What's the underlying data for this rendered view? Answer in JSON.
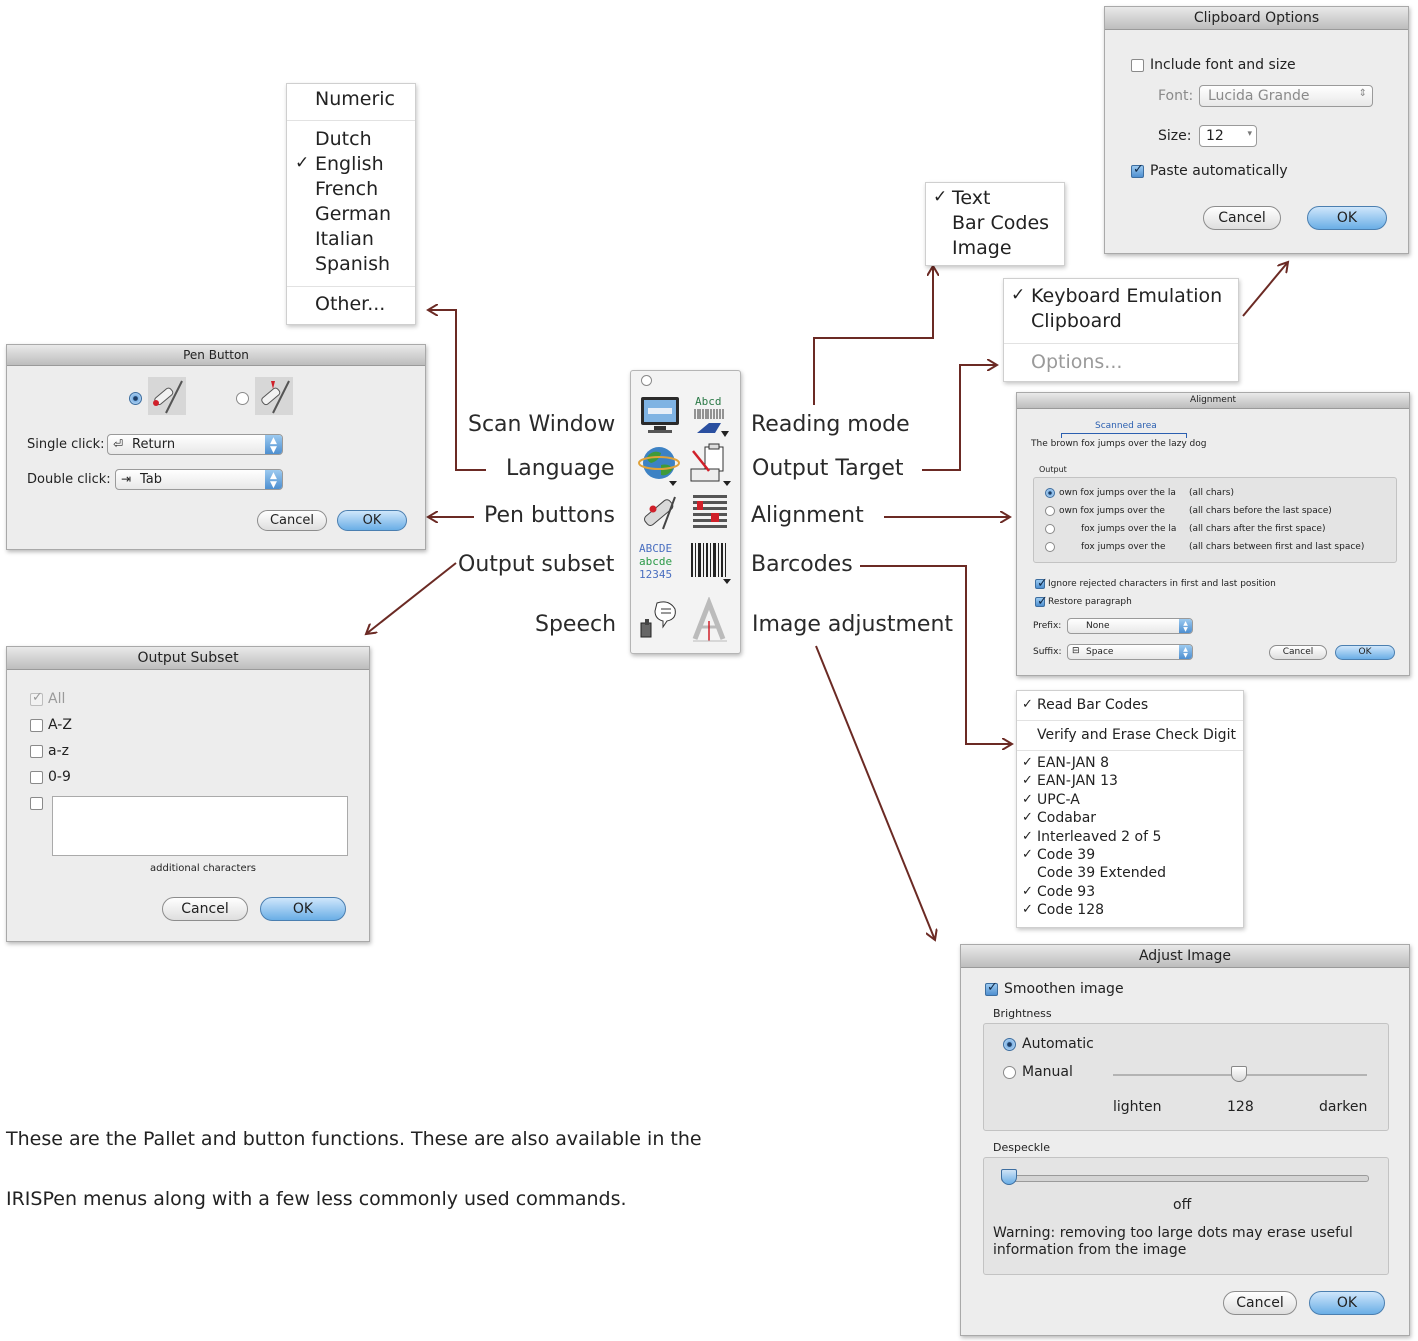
{
  "language_menu": {
    "items": [
      "Numeric",
      "Dutch",
      "English",
      "French",
      "German",
      "Italian",
      "Spanish",
      "Other..."
    ],
    "checked": "English"
  },
  "pen_button": {
    "title": "Pen Button",
    "single_click_label": "Single click:",
    "single_click_value": "Return",
    "double_click_label": "Double click:",
    "double_click_value": "Tab",
    "cancel": "Cancel",
    "ok": "OK"
  },
  "output_subset": {
    "title": "Output Subset",
    "options": [
      "All",
      "A-Z",
      "a-z",
      "0-9"
    ],
    "additional_label": "additional characters",
    "cancel": "Cancel",
    "ok": "OK"
  },
  "palette": {
    "left_labels": [
      "Scan Window",
      "Language",
      "Pen buttons",
      "Output subset",
      "Speech"
    ],
    "right_labels": [
      "Reading mode",
      "Output Target",
      "Alignment",
      "Barcodes",
      "Image adjustment"
    ],
    "icon_texts": {
      "abcd": "Abcd",
      "abcde_upper": "ABCDE",
      "abcde_lower": "abcde",
      "digits": "12345"
    }
  },
  "reading_mode_menu": {
    "items": [
      "Text",
      "Bar Codes",
      "Image"
    ],
    "checked": "Text"
  },
  "output_target_menu": {
    "items": [
      "Keyboard Emulation",
      "Clipboard"
    ],
    "checked": "Keyboard Emulation",
    "options": "Options..."
  },
  "clipboard_options": {
    "title": "Clipboard Options",
    "include_font": "Include font and size",
    "font_label": "Font:",
    "font_value": "Lucida Grande",
    "size_label": "Size:",
    "size_value": "12",
    "paste_auto": "Paste automatically",
    "cancel": "Cancel",
    "ok": "OK"
  },
  "alignment": {
    "title": "Alignment",
    "scanned_area": "Scanned area",
    "sample_text": "The brown fox jumps over the lazy dog",
    "output_label": "Output",
    "options": [
      {
        "text": "own fox jumps over the la",
        "desc": "(all chars)"
      },
      {
        "text": "own fox jumps over the",
        "desc": "(all chars before the last space)"
      },
      {
        "text": "fox jumps over the la",
        "desc": "(all chars after the first space)"
      },
      {
        "text": "fox jumps over the",
        "desc": "(all chars between first and last space)"
      }
    ],
    "ignore_rejected": "Ignore rejected characters in first and last position",
    "restore_paragraph": "Restore paragraph",
    "prefix_label": "Prefix:",
    "prefix_value": "None",
    "suffix_label": "Suffix:",
    "suffix_value": "Space",
    "cancel": "Cancel",
    "ok": "OK"
  },
  "barcodes_menu": {
    "read": "Read Bar Codes",
    "verify": "Verify and Erase Check Digit",
    "items": [
      {
        "label": "EAN-JAN 8",
        "checked": true
      },
      {
        "label": "EAN-JAN 13",
        "checked": true
      },
      {
        "label": "UPC-A",
        "checked": true
      },
      {
        "label": "Codabar",
        "checked": true
      },
      {
        "label": "Interleaved 2 of 5",
        "checked": true
      },
      {
        "label": "Code 39",
        "checked": true
      },
      {
        "label": "Code 39 Extended",
        "checked": false
      },
      {
        "label": "Code 93",
        "checked": true
      },
      {
        "label": "Code 128",
        "checked": true
      }
    ]
  },
  "adjust_image": {
    "title": "Adjust Image",
    "smoothen": "Smoothen image",
    "brightness_label": "Brightness",
    "automatic": "Automatic",
    "manual": "Manual",
    "lighten": "lighten",
    "brightness_value": "128",
    "darken": "darken",
    "despeckle_label": "Despeckle",
    "despeckle_value": "off",
    "warning": "Warning: removing too large dots may erase useful information from the image",
    "cancel": "Cancel",
    "ok": "OK"
  },
  "caption": {
    "line1": "These are the Pallet and button functions. These are also available in the",
    "line2": "IRISPen menus along with a few less commonly used commands."
  },
  "colors": {
    "arrow": "#6b2a24",
    "accent": "#4e8fd0"
  }
}
